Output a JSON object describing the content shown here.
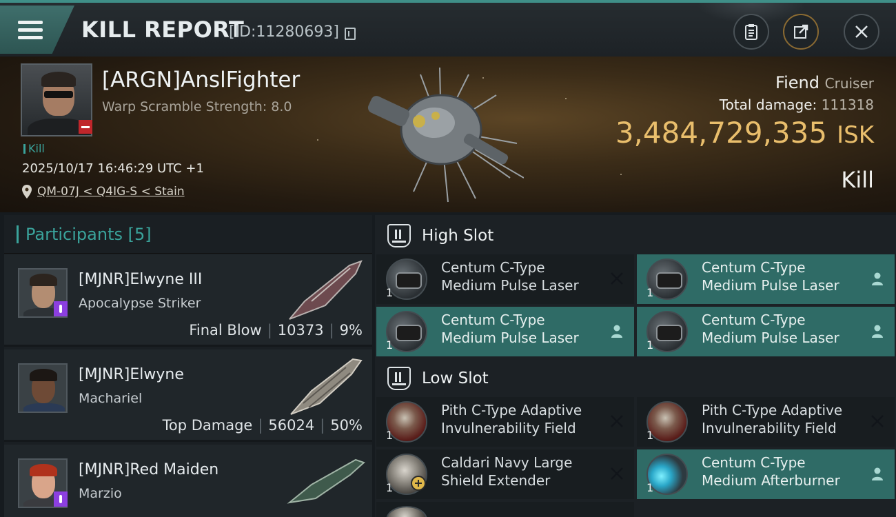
{
  "header": {
    "title": "KILL REPORT",
    "report_id": "[ID:11280693]"
  },
  "victim": {
    "name": "[ARGN]AnslFighter",
    "warp_scramble": "Warp Scramble Strength: 8.0",
    "kill_tag": "Kill",
    "datetime": "2025/10/17 16:46:29 UTC +1",
    "location": "QM-07J < Q4IG-S < Stain"
  },
  "ship": {
    "name": "Fiend",
    "class": "Cruiser",
    "total_damage_label": "Total damage:",
    "total_damage": "111318",
    "isk_value": "3,484,729,335",
    "isk_unit": "ISK",
    "result": "Kill"
  },
  "participants": {
    "title": "Participants [5]",
    "items": [
      {
        "name": "[MJNR]Elwyne III",
        "ship": "Apocalypse Striker",
        "role": "Final Blow",
        "damage": "10373",
        "percent": "9%"
      },
      {
        "name": "[MJNR]Elwyne",
        "ship": "Machariel",
        "role": "Top Damage",
        "damage": "56024",
        "percent": "50%"
      },
      {
        "name": "[MJNR]Red Maiden",
        "ship": "Marzio",
        "role": "",
        "damage": "",
        "percent": ""
      }
    ]
  },
  "fittings": {
    "high_slot": {
      "title": "High Slot",
      "modules": [
        {
          "line1": "Centum C-Type",
          "line2": "Medium Pulse Laser",
          "qty": "1",
          "status": "destroyed"
        },
        {
          "line1": "Centum C-Type",
          "line2": "Medium Pulse Laser",
          "qty": "1",
          "status": "dropped"
        },
        {
          "line1": "Centum C-Type",
          "line2": "Medium Pulse Laser",
          "qty": "1",
          "status": "dropped"
        },
        {
          "line1": "Centum C-Type",
          "line2": "Medium Pulse Laser",
          "qty": "1",
          "status": "dropped"
        }
      ]
    },
    "low_slot": {
      "title": "Low Slot",
      "modules": [
        {
          "line1": "Pith C-Type Adaptive",
          "line2": "Invulnerability Field",
          "qty": "1",
          "status": "destroyed"
        },
        {
          "line1": "Pith C-Type Adaptive",
          "line2": "Invulnerability Field",
          "qty": "1",
          "status": "destroyed"
        },
        {
          "line1": "Caldari Navy Large",
          "line2": "Shield Extender",
          "qty": "1",
          "status": "destroyed"
        },
        {
          "line1": "Centum C-Type",
          "line2": "Medium Afterburner",
          "qty": "1",
          "status": "dropped"
        }
      ]
    }
  },
  "colors": {
    "accent_teal": "#3aa39b",
    "isk_gold": "#e9be6c",
    "dropped_bg": "#2f6b66",
    "destroyed_bg": "#181d20"
  }
}
